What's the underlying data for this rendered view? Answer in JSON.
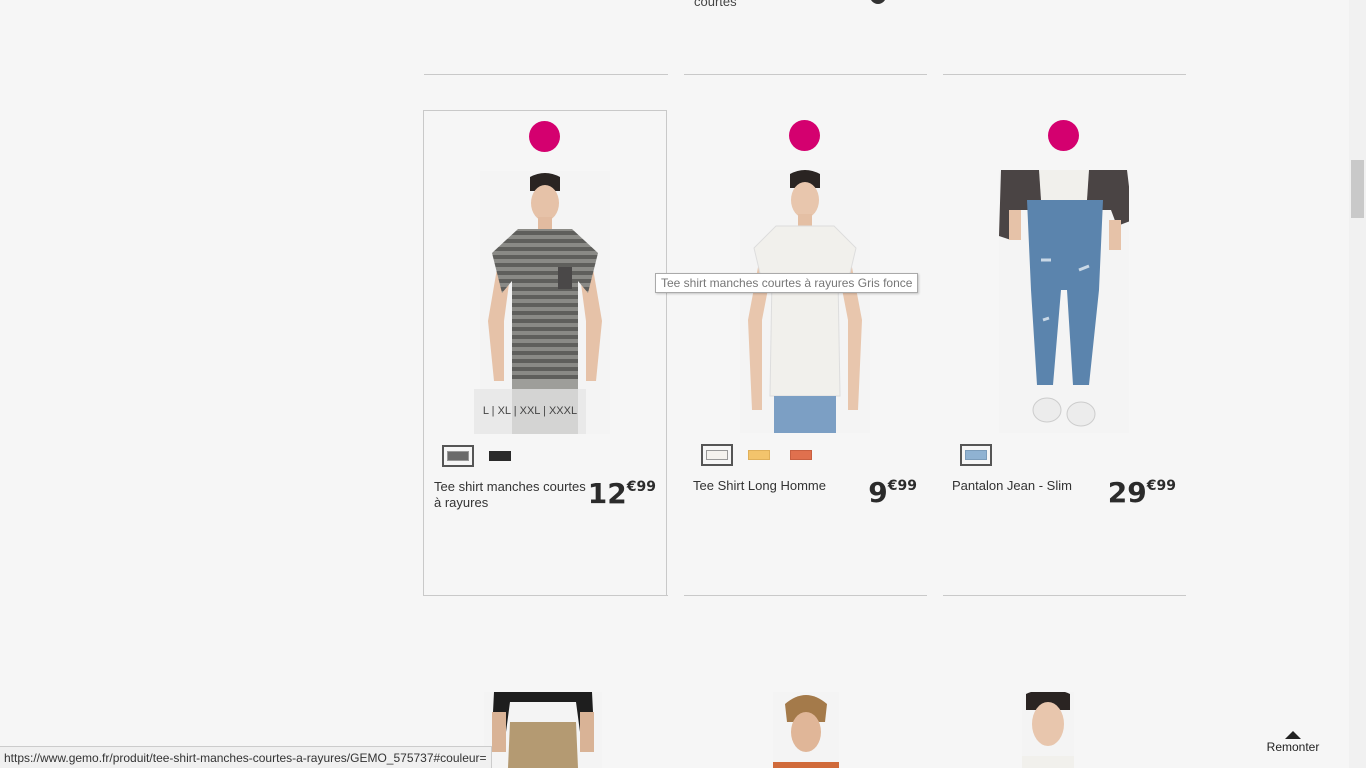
{
  "top_row": {
    "name_fragment": "courtes"
  },
  "products": [
    {
      "name": "Tee shirt manches courtes à rayures",
      "price_int": "12",
      "price_cents": "€99",
      "sizes": "L | XL | XXL | XXXL",
      "badge_color": "#d4006f",
      "swatches": [
        {
          "color": "#6b6b6b",
          "selected": true
        },
        {
          "color": "#2a2a2a",
          "selected": false
        }
      ]
    },
    {
      "name": "Tee Shirt Long Homme",
      "price_int": "9",
      "price_cents": "€99",
      "badge_color": "#d4006f",
      "swatches": [
        {
          "color": "#f4f2ee",
          "selected": true
        },
        {
          "color": "#f3c46c",
          "selected": false
        },
        {
          "color": "#e0704e",
          "selected": false
        }
      ]
    },
    {
      "name": "Pantalon Jean - Slim",
      "price_int": "29",
      "price_cents": "€99",
      "badge_color": "#d4006f",
      "swatches": [
        {
          "color": "#8fb2d2",
          "selected": true
        }
      ]
    }
  ],
  "tooltip": "Tee shirt manches courtes à rayures Gris fonce",
  "status_url": "https://www.gemo.fr/produit/tee-shirt-manches-courtes-a-rayures/GEMO_575737#couleur=",
  "back_to_top": "Remonter",
  "colors": {
    "badge": "#d4006f",
    "background": "#f6f6f6",
    "separator": "#c9c9c9"
  }
}
